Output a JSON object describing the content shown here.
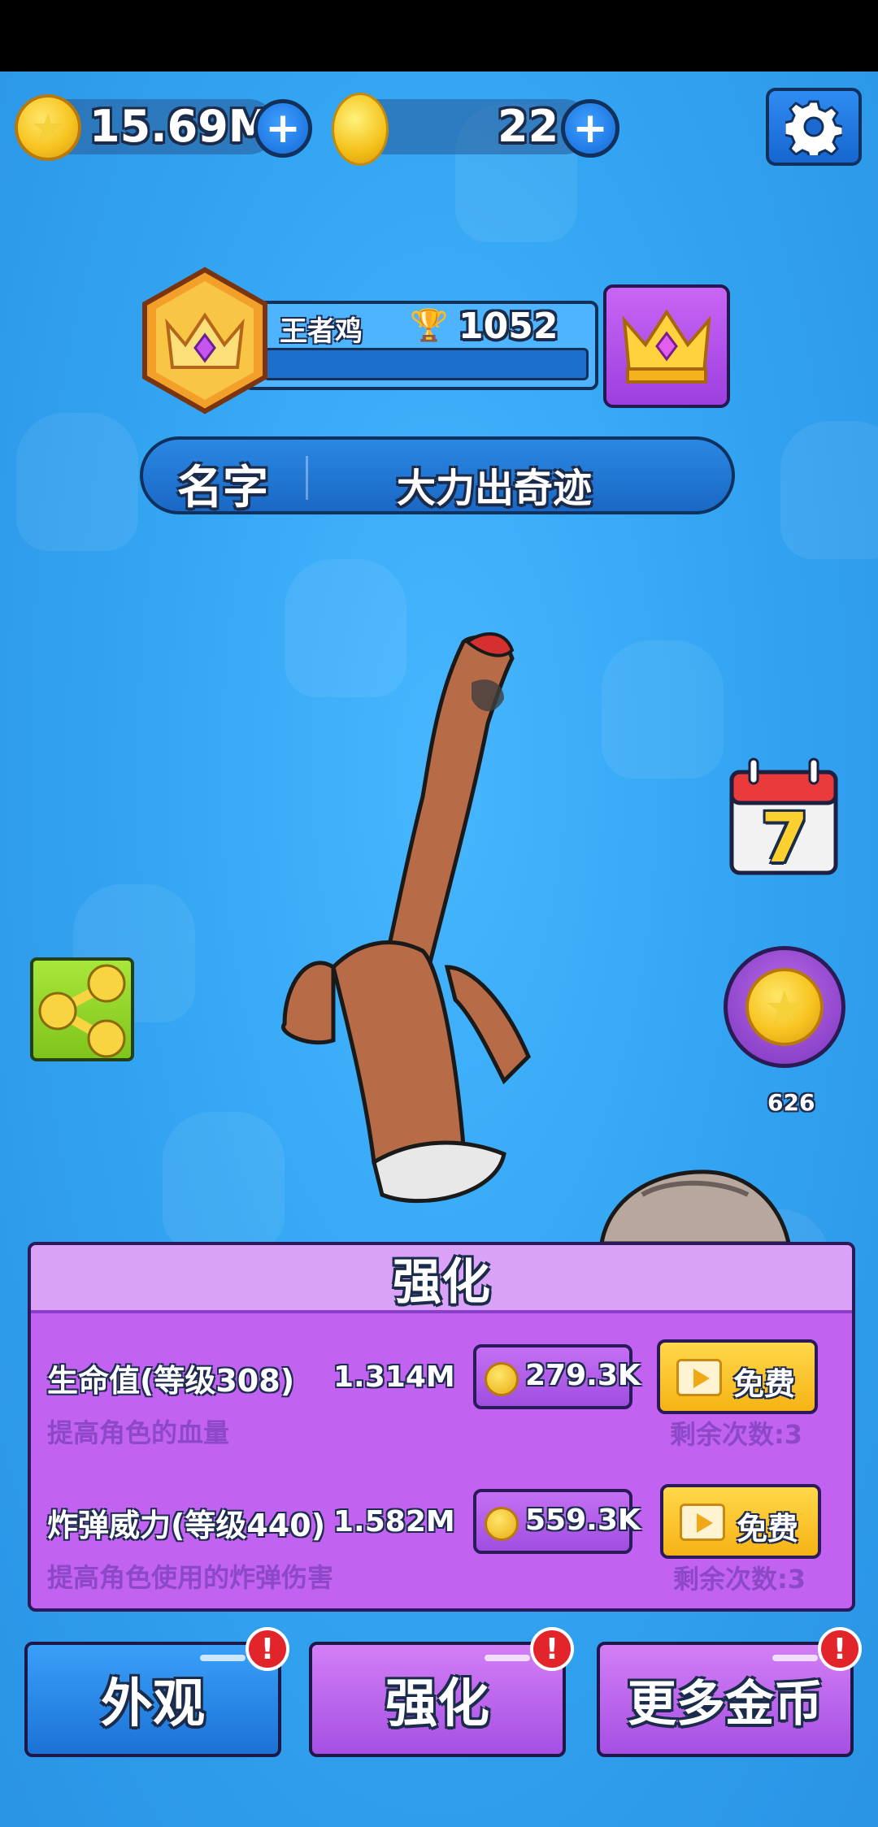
{
  "currency": {
    "coins": "15.69M",
    "eggs": "22"
  },
  "rank": {
    "title": "王者鸡",
    "trophies": "1052"
  },
  "name": {
    "label": "名字",
    "value": "大力出奇迹"
  },
  "daily": {
    "day_number": "7"
  },
  "coin_reward": {
    "count": "626"
  },
  "panel": {
    "title": "强化",
    "rows": [
      {
        "name": "生命值(等级308)",
        "value": "1.314M",
        "desc": "提高角色的血量",
        "price": "279.3K",
        "free_label": "免费",
        "remaining": "剩余次数:3"
      },
      {
        "name": "炸弹威力(等级440)",
        "value": "1.582M",
        "desc": "提高角色使用的炸弹伤害",
        "price": "559.3K",
        "free_label": "免费",
        "remaining": "剩余次数:3"
      }
    ]
  },
  "tabs": [
    {
      "label": "外观",
      "alert": "!"
    },
    {
      "label": "强化",
      "alert": "!"
    },
    {
      "label": "更多金币",
      "alert": "!"
    }
  ],
  "colors": {
    "sky": "#34a6f3",
    "panel_purple": "#c163f0",
    "tab_blue": "#2f8cf2",
    "tab_purple": "#c46ff3",
    "free_yellow": "#f6b316"
  }
}
